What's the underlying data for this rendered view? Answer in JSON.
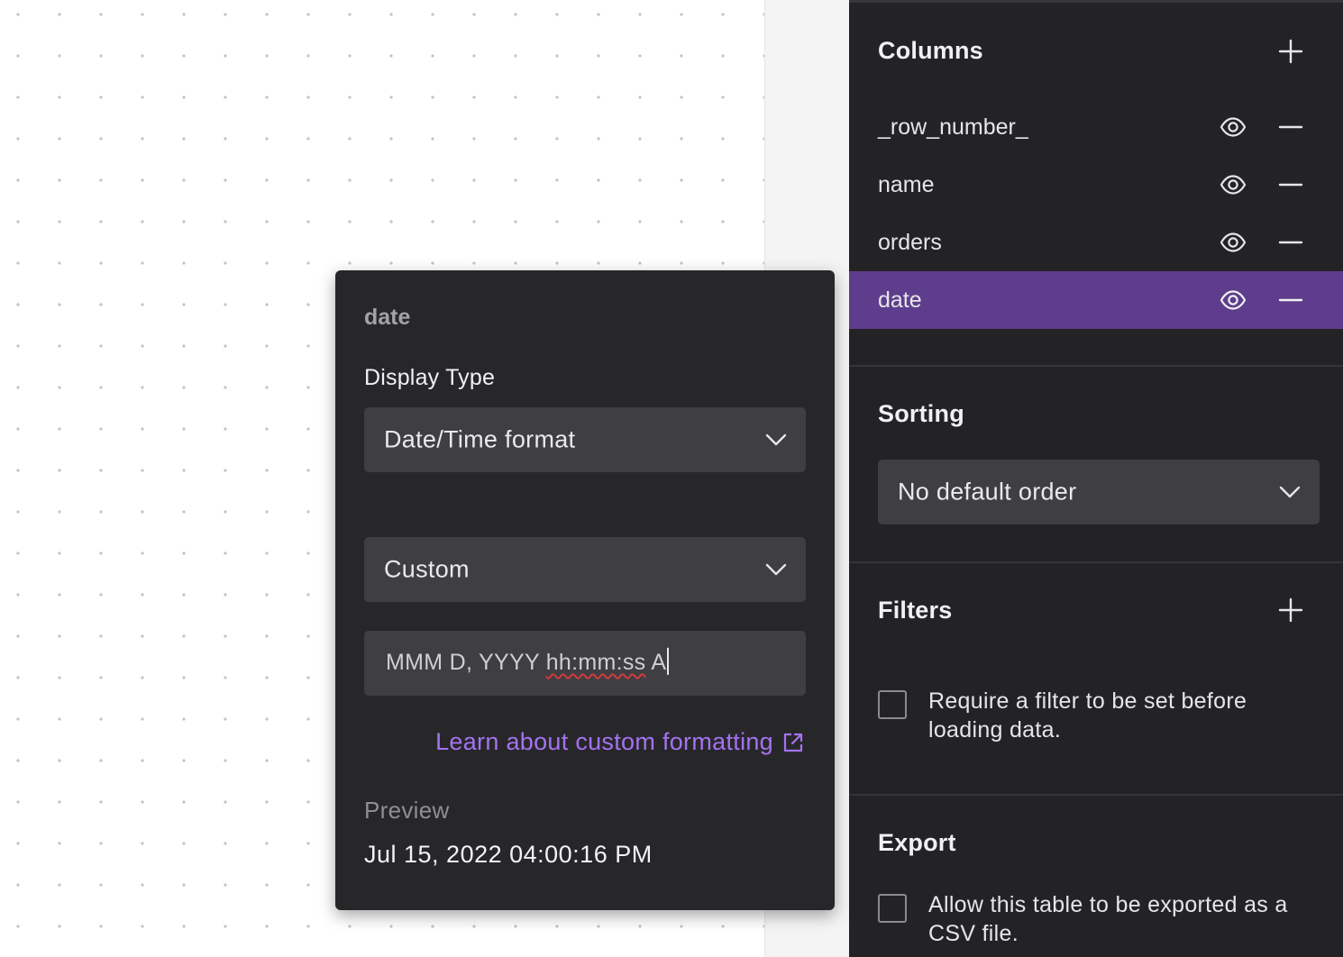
{
  "popover": {
    "title": "date",
    "display_type_label": "Display Type",
    "display_type_value": "Date/Time format",
    "format_preset_value": "Custom",
    "custom_format_prefix": "MMM D, YYYY ",
    "custom_format_misspelled": "hh:mm:ss",
    "custom_format_suffix": " A",
    "learn_link_label": "Learn about custom formatting",
    "preview_label": "Preview",
    "preview_value": "Jul 15, 2022 04:00:16 PM"
  },
  "sidebar": {
    "columns": {
      "title": "Columns",
      "items": [
        {
          "label": "_row_number_",
          "active": false
        },
        {
          "label": "name",
          "active": false
        },
        {
          "label": "orders",
          "active": false
        },
        {
          "label": "date",
          "active": true
        }
      ]
    },
    "sorting": {
      "title": "Sorting",
      "selected": "No default order"
    },
    "filters": {
      "title": "Filters",
      "require_filter_label": "Require a filter to be set before loading data.",
      "require_filter_checked": false
    },
    "export": {
      "title": "Export",
      "allow_export_label": "Allow this table to be exported as a CSV file.",
      "allow_export_checked": false
    }
  },
  "colors": {
    "sidebar_bg": "#232326",
    "popover_bg": "#27272a",
    "active_row": "#5e3d8c",
    "link": "#a572f0",
    "input_bg": "#3e3e43"
  }
}
